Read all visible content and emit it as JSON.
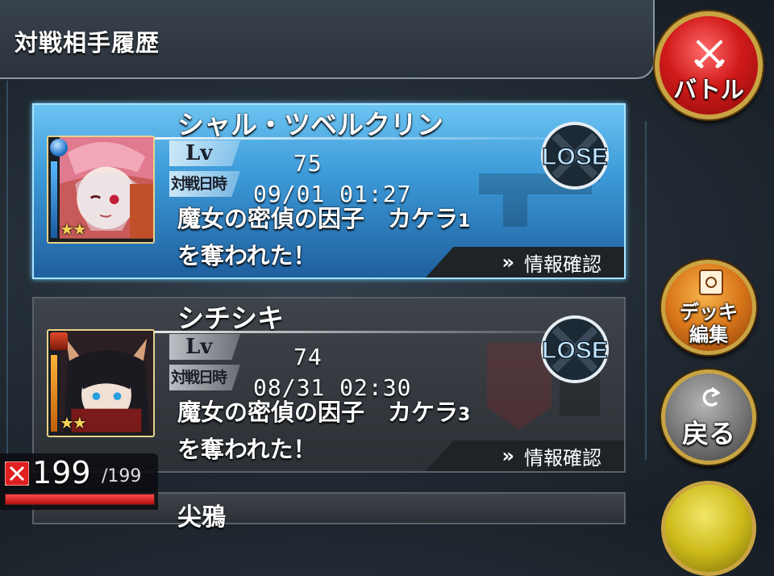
{
  "header": {
    "title": "対戦相手履歴"
  },
  "side_buttons": {
    "battle": "バトル",
    "deck_line1": "デッキ",
    "deck_line2": "編集",
    "back": "戻る"
  },
  "history": [
    {
      "name": "シャル・ツベルクリン",
      "lv_label": "Lv",
      "level": "75",
      "date_label": "対戦日時",
      "datetime": "09/01  01:27",
      "message_line1": "魔女の密偵の因子　カケラ",
      "message_count": "1",
      "message_line2": "を奪われた！",
      "result": "LOSE",
      "stars": "★★",
      "info_label": "情報確認",
      "selected": true
    },
    {
      "name": "シチシキ",
      "lv_label": "Lv",
      "level": "74",
      "date_label": "対戦日時",
      "datetime": "08/31  02:30",
      "message_line1": "魔女の密偵の因子　カケラ",
      "message_count": "3",
      "message_line2": "を奪われた！",
      "result": "LOSE",
      "stars": "★★",
      "info_label": "情報確認",
      "selected": false
    }
  ],
  "next_entry_partial_name": "尖鴉",
  "stamina": {
    "current": "199",
    "max": "/199",
    "fraction": 1.0
  },
  "colors": {
    "accent_blue": "#3d9ad8",
    "battle_red": "#d11a1a",
    "deck_orange": "#d8751a",
    "gold_border": "#c9a442"
  }
}
